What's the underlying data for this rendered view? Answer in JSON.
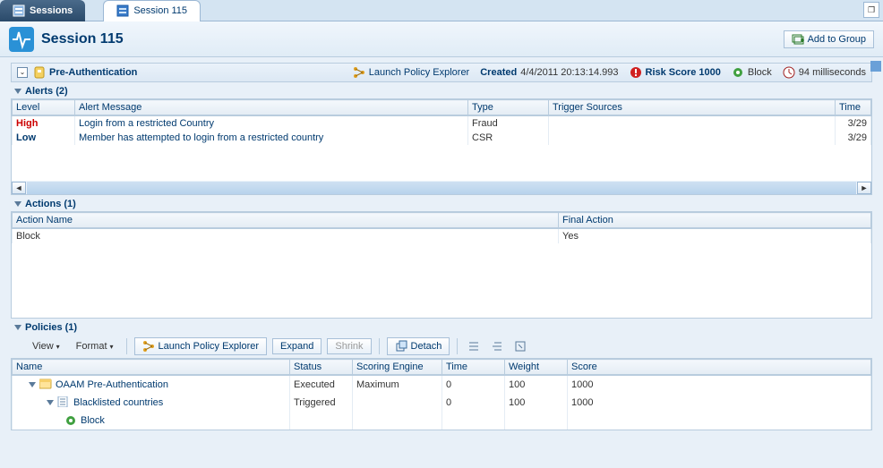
{
  "tabs": {
    "sessions": "Sessions",
    "session_detail": "Session 115"
  },
  "header": {
    "title": "Session 115",
    "add_to_group": "Add to Group"
  },
  "preauth": {
    "title": "Pre-Authentication",
    "launch_policy_explorer": "Launch Policy Explorer",
    "created_label": "Created",
    "created_value": "4/4/2011 20:13:14.993",
    "risk_label": "Risk Score 1000",
    "block_label": "Block",
    "time_label": "94 milliseconds"
  },
  "alerts": {
    "title": "Alerts (2)",
    "cols": {
      "level": "Level",
      "msg": "Alert Message",
      "type": "Type",
      "triggers": "Trigger Sources",
      "time": "Time"
    },
    "rows": [
      {
        "level": "High",
        "level_cls": "lvl-high",
        "msg": "Login from a restricted Country",
        "type": "Fraud",
        "triggers": "",
        "time": "3/29"
      },
      {
        "level": "Low",
        "level_cls": "lvl-low",
        "msg": "Member has attempted to login from a restricted country",
        "type": "CSR",
        "triggers": "",
        "time": "3/29"
      }
    ]
  },
  "actions": {
    "title": "Actions (1)",
    "cols": {
      "name": "Action Name",
      "final": "Final Action"
    },
    "rows": [
      {
        "name": "Block",
        "final": "Yes"
      }
    ]
  },
  "policies": {
    "title": "Policies (1)",
    "toolbar": {
      "view": "View",
      "format": "Format",
      "launch": "Launch Policy Explorer",
      "expand": "Expand",
      "shrink": "Shrink",
      "detach": "Detach"
    },
    "cols": {
      "name": "Name",
      "status": "Status",
      "scoring": "Scoring Engine",
      "time": "Time",
      "weight": "Weight",
      "score": "Score"
    },
    "rows": [
      {
        "indent": "indent1",
        "icon": "policy",
        "tri": true,
        "name": "OAAM Pre-Authentication",
        "status": "Executed",
        "scoring": "Maximum",
        "time": "0",
        "weight": "100",
        "score": "1000"
      },
      {
        "indent": "indent2",
        "icon": "rule",
        "tri": true,
        "name": "Blacklisted countries",
        "status": "Triggered",
        "scoring": "",
        "time": "0",
        "weight": "100",
        "score": "1000"
      },
      {
        "indent": "indent3",
        "icon": "gear",
        "tri": false,
        "name": "Block",
        "status": "",
        "scoring": "",
        "time": "",
        "weight": "",
        "score": ""
      }
    ]
  }
}
